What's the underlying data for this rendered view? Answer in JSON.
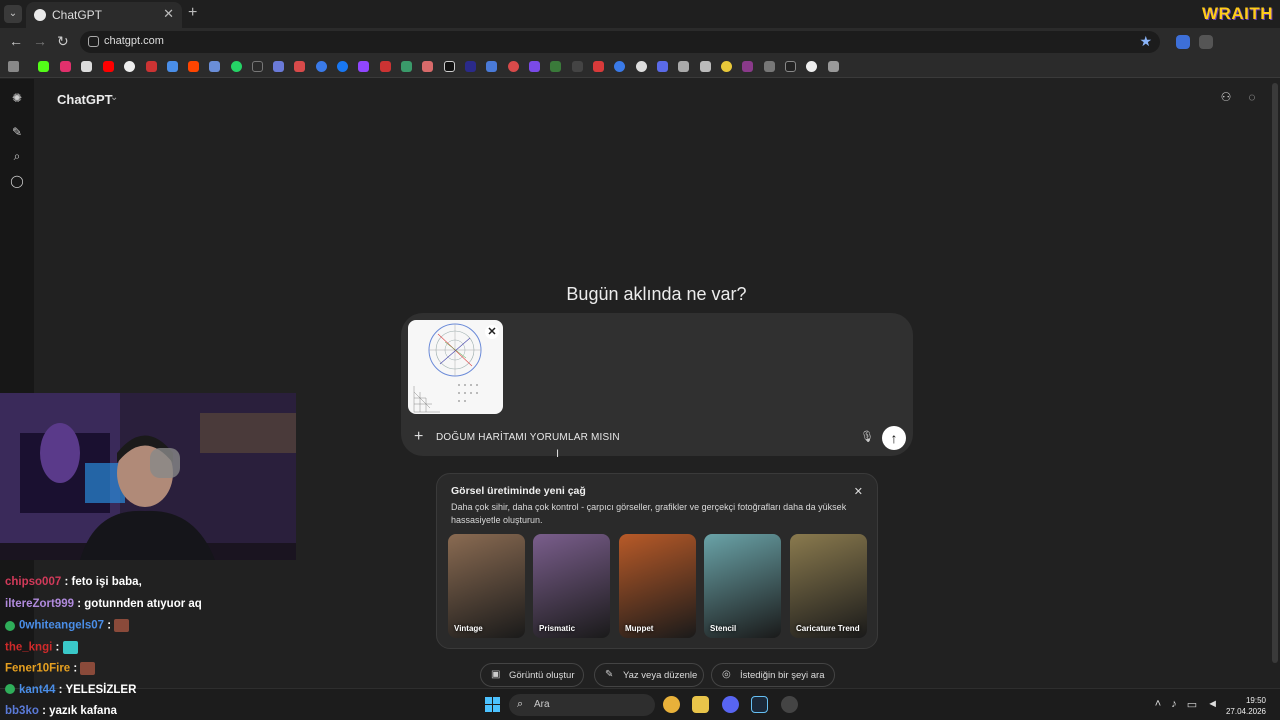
{
  "browser": {
    "tab_title": "ChatGPT",
    "url": "chatgpt.com",
    "brand_overlay": "WRAITH"
  },
  "app": {
    "model_title": "ChatGPT",
    "heading": "Bugün aklında ne var?",
    "composer": {
      "prompt": "DOĞUM HARİTAMI YORUMLAR MISIN"
    },
    "promo": {
      "title": "Görsel üretiminde yeni çağ",
      "description": "Daha çok sihir, daha çok kontrol - çarpıcı görseller, grafikler ve gerçekçi fotoğrafları daha da yüksek hassasiyetle oluşturun.",
      "cards": [
        {
          "label": "Vintage",
          "color": "#8a6b52"
        },
        {
          "label": "Prismatic",
          "color": "#7a5e8c"
        },
        {
          "label": "Muppet",
          "color": "#b85a28"
        },
        {
          "label": "Stencil",
          "color": "#6aa3a8"
        },
        {
          "label": "Caricature Trend",
          "color": "#8a7a4e"
        }
      ]
    },
    "actions": [
      {
        "label": "Görüntü oluştur"
      },
      {
        "label": "Yaz veya düzenle"
      },
      {
        "label": "İstediğin bir şeyi ara"
      }
    ]
  },
  "taskbar": {
    "search_placeholder": "Ara",
    "time": "19:50",
    "date": "27.04.2026"
  },
  "stream_chat": [
    {
      "user": "chipso007",
      "user_color": "#d23a5a",
      "message": "feto işi baba,"
    },
    {
      "user": "iltereZort999",
      "user_color": "#b08adc",
      "message": "gotunnden atıyuor aq"
    },
    {
      "user": "0whiteangels07",
      "user_color": "#4a8ee8",
      "message": "",
      "badge": true,
      "emote": true
    },
    {
      "user": "the_kngi",
      "user_color": "#d02a2a",
      "message": "",
      "emote": true
    },
    {
      "user": "Fener10Fire",
      "user_color": "#e6a020",
      "message": "",
      "emote": true
    },
    {
      "user": "kant44",
      "user_color": "#4a8ee8",
      "message": "YELESİZLER",
      "badge": true
    },
    {
      "user": "bb3ko",
      "user_color": "#5a7ad8",
      "message": "yazık kafana"
    }
  ],
  "colors": {
    "app_bg": "#212121",
    "rail_bg": "#171717",
    "composer_bg": "#303030",
    "accent_star": "#8ab4f8"
  }
}
